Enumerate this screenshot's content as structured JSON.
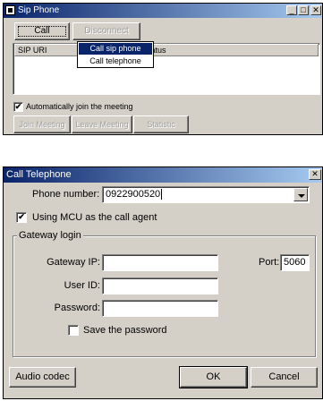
{
  "sip_window": {
    "title": "Sip Phone",
    "call_button": "Call",
    "disconnect_button": "Disconnect",
    "call_menu": [
      "Call sip phone",
      "Call telephone"
    ],
    "table_headers": [
      "SIP URI",
      "Status"
    ],
    "auto_join_label": "Automatically join the meeting",
    "auto_join_checked": "✔",
    "join_button": "Join Meeting",
    "leave_button": "Leave Meeting",
    "statistic_button": "Statistic",
    "caption_buttons": {
      "minimize": "_",
      "maximize": "□",
      "close": "✕"
    }
  },
  "call_dialog": {
    "title": "Call Telephone",
    "close": "✕",
    "phone_label": "Phone number:",
    "phone_value": "0922900520",
    "use_mcu_label": "Using MCU as the call agent",
    "use_mcu_checked": "✔",
    "gateway_group": "Gateway login",
    "gateway_ip_label": "Gateway IP:",
    "gateway_ip_value": "",
    "port_label": "Port:",
    "port_value": "5060",
    "user_id_label": "User ID:",
    "user_id_value": "",
    "password_label": "Password:",
    "password_value": "",
    "save_password_label": "Save the password",
    "save_password_checked": "",
    "audio_codec_button": "Audio codec",
    "ok_button": "OK",
    "cancel_button": "Cancel"
  },
  "colors": {
    "title_bar_start": "#0a246a",
    "title_bar_end": "#a6caf0",
    "face": "#d4d0c8",
    "selection": "#0a246a"
  }
}
